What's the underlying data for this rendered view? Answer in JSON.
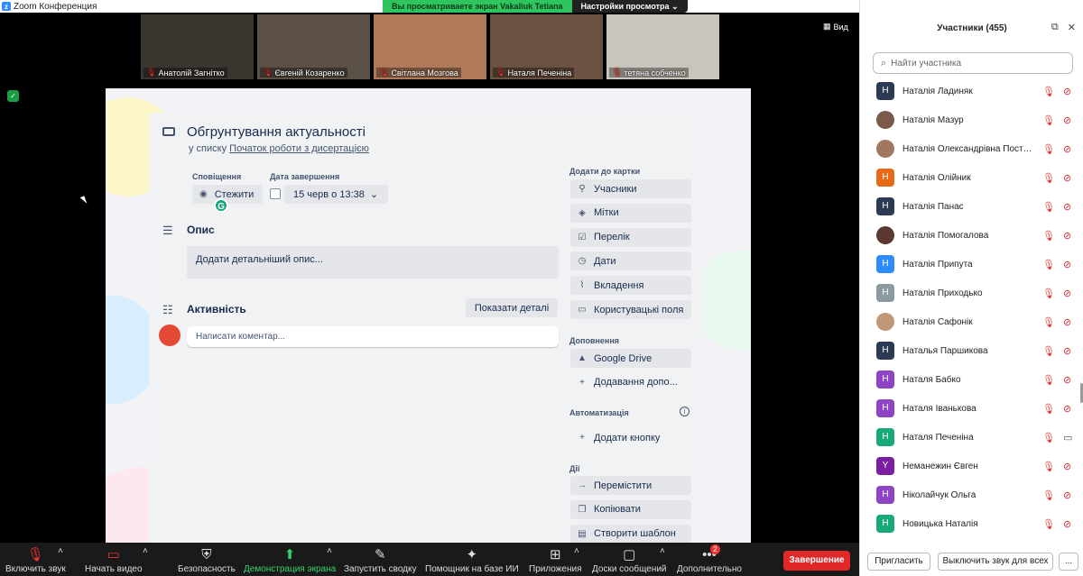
{
  "window": {
    "title": "Zoom Конференция"
  },
  "share_bar": {
    "viewing": "Вы просматриваете экран Vakaliuk Tetiana",
    "options": "Настройки просмотра"
  },
  "view_button": "Вид",
  "thumbnails": [
    {
      "name": "Анатолій Загнітко",
      "color": "#3b3530"
    },
    {
      "name": "Євгеній Козаренко",
      "color": "#5a5046"
    },
    {
      "name": "Світлана Мозгова",
      "color": "#b07a5a"
    },
    {
      "name": "Наталя Печеніна",
      "color": "#6b5140"
    },
    {
      "name": "тетяна собченко",
      "color": "#c9c4bc"
    }
  ],
  "card": {
    "title": "Обгрунтування актуальності",
    "list_prefix": "у списку",
    "list_name": "Початок роботи з дисертацією",
    "notifications_label": "Сповіщення",
    "watch_button": "Стежити",
    "due_label": "Дата завершення",
    "due_value": "15 черв о 13:38",
    "description_heading": "Опис",
    "description_placeholder": "Додати детальніший опис...",
    "activity_heading": "Активність",
    "show_details": "Показати деталі",
    "comment_placeholder": "Написати коментар...",
    "add_to_card_label": "Додати до картки",
    "add_to_card": [
      {
        "label": "Учасники",
        "icon": "person-icon"
      },
      {
        "label": "Мітки",
        "icon": "tag-icon"
      },
      {
        "label": "Перелік",
        "icon": "checklist-icon"
      },
      {
        "label": "Дати",
        "icon": "clock-icon"
      },
      {
        "label": "Вкладення",
        "icon": "paperclip-icon"
      },
      {
        "label": "Користувацькі поля",
        "icon": "fields-icon"
      }
    ],
    "powerups_label": "Доповнення",
    "powerups": [
      {
        "label": "Google Drive",
        "icon": "drive-icon"
      },
      {
        "label": "Додавання допо...",
        "icon": "plus-icon"
      }
    ],
    "automation_label": "Автоматизація",
    "automation": [
      {
        "label": "Додати кнопку",
        "icon": "plus-icon"
      }
    ],
    "actions_label": "Дії",
    "actions": [
      {
        "label": "Перемістити",
        "icon": "arrow-right-icon"
      },
      {
        "label": "Копіювати",
        "icon": "copy-icon"
      },
      {
        "label": "Створити шаблон",
        "icon": "template-icon"
      }
    ]
  },
  "toolbar": {
    "audio": "Включить звук",
    "video": "Начать видео",
    "security": "Безопасность",
    "share": "Демонстрация экрана",
    "summary": "Запустить сводку",
    "ai": "Помощник на базе ИИ",
    "apps": "Приложения",
    "whiteboards": "Доски сообщений",
    "more": "Дополнительно",
    "more_badge": "2",
    "end": "Завершение"
  },
  "participants_panel": {
    "title": "Участники (455)",
    "search_placeholder": "Найти участника",
    "invite": "Пригласить",
    "mute_all": "Выключить звук для всех",
    "more": "...",
    "participants": [
      {
        "name": "Наталія Ладиняк",
        "initial": "Н",
        "color": "#2b3a55",
        "photo": false
      },
      {
        "name": "Наталія Мазур",
        "initial": "",
        "color": "#7a5a48",
        "photo": true
      },
      {
        "name": "Наталія Олександрівна Постер...",
        "initial": "",
        "color": "#a07860",
        "photo": true
      },
      {
        "name": "Наталія Олійник",
        "initial": "Н",
        "color": "#e86a17",
        "photo": false
      },
      {
        "name": "Наталія Панас",
        "initial": "Н",
        "color": "#2b3a55",
        "photo": false
      },
      {
        "name": "Наталія Помогалова",
        "initial": "",
        "color": "#5a3a30",
        "photo": true
      },
      {
        "name": "Наталія Припута",
        "initial": "Н",
        "color": "#2d8cff",
        "photo": false
      },
      {
        "name": "Наталія Приходько",
        "initial": "Н",
        "color": "#8a9aa0",
        "photo": false
      },
      {
        "name": "Наталія Сафонік",
        "initial": "",
        "color": "#c09878",
        "photo": true
      },
      {
        "name": "Наталья Паршикова",
        "initial": "Н",
        "color": "#2b3a55",
        "photo": false
      },
      {
        "name": "Наталя Бабко",
        "initial": "Н",
        "color": "#8e44c4",
        "photo": false
      },
      {
        "name": "Наталя Іванькова",
        "initial": "Н",
        "color": "#8e44c4",
        "photo": false
      },
      {
        "name": "Наталя Печеніна",
        "initial": "Н",
        "color": "#18a87a",
        "photo": false,
        "video_on": true
      },
      {
        "name": "Неманежин Євген",
        "initial": "Y",
        "color": "#7a1fa2",
        "photo": false
      },
      {
        "name": "Ніколайчук Ольга",
        "initial": "Н",
        "color": "#8e44c4",
        "photo": false
      },
      {
        "name": "Новицька Наталія",
        "initial": "Н",
        "color": "#18a87a",
        "photo": false
      }
    ]
  }
}
